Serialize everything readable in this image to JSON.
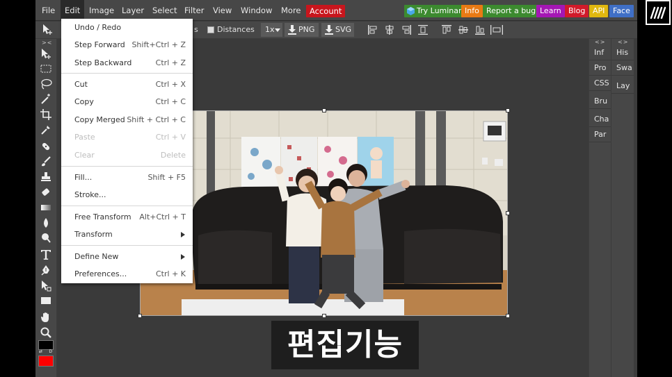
{
  "menubar": {
    "items": [
      "File",
      "Edit",
      "Image",
      "Layer",
      "Select",
      "Filter",
      "View",
      "Window",
      "More"
    ],
    "account": "Account",
    "links": [
      {
        "label": "Try Luminar",
        "color": "#3c8a2f"
      },
      {
        "label": "Info",
        "color": "#e97a14"
      },
      {
        "label": "Report a bug",
        "color": "#3c8a2f"
      },
      {
        "label": "Learn",
        "color": "#a417b4"
      },
      {
        "label": "Blog",
        "color": "#d11a2a"
      },
      {
        "label": "API",
        "color": "#e0b80f"
      },
      {
        "label": "Face",
        "color": "#3f6fc6"
      }
    ]
  },
  "options": {
    "partial_label": "s",
    "distances_label": "Distances",
    "zoom": "1x",
    "png_label": "PNG",
    "svg_label": "SVG"
  },
  "edit_menu": {
    "items": [
      {
        "label": "Undo / Redo",
        "shortcut": ""
      },
      {
        "label": "Step Forward",
        "shortcut": "Shift+Ctrl + Z"
      },
      {
        "label": "Step Backward",
        "shortcut": "Ctrl + Z"
      },
      {
        "label": "Cut",
        "shortcut": "Ctrl + X"
      },
      {
        "label": "Copy",
        "shortcut": "Ctrl + C"
      },
      {
        "label": "Copy Merged",
        "shortcut": "Shift + Ctrl + C"
      },
      {
        "label": "Paste",
        "shortcut": "Ctrl + V",
        "disabled": true
      },
      {
        "label": "Clear",
        "shortcut": "Delete",
        "disabled": true
      },
      {
        "label": "Fill...",
        "shortcut": "Shift + F5"
      },
      {
        "label": "Stroke...",
        "shortcut": ""
      },
      {
        "label": "Free Transform",
        "shortcut": "Alt+Ctrl + T"
      },
      {
        "label": "Transform",
        "shortcut": ""
      },
      {
        "label": "Define New",
        "shortcut": ""
      },
      {
        "label": "Preferences...",
        "shortcut": "Ctrl + K"
      }
    ]
  },
  "panels": {
    "left": [
      "Inf",
      "Pro",
      "CSS",
      "Bru",
      "Cha",
      "Par"
    ],
    "right": [
      "His",
      "Swa",
      "Lay"
    ],
    "collapse_glyph": "<>",
    "toolbar_collapse_glyph": "><"
  },
  "colors": {
    "foreground": "#000000",
    "background": "#ff0000",
    "account_bg": "#c8161d"
  },
  "caption": "편집기능"
}
